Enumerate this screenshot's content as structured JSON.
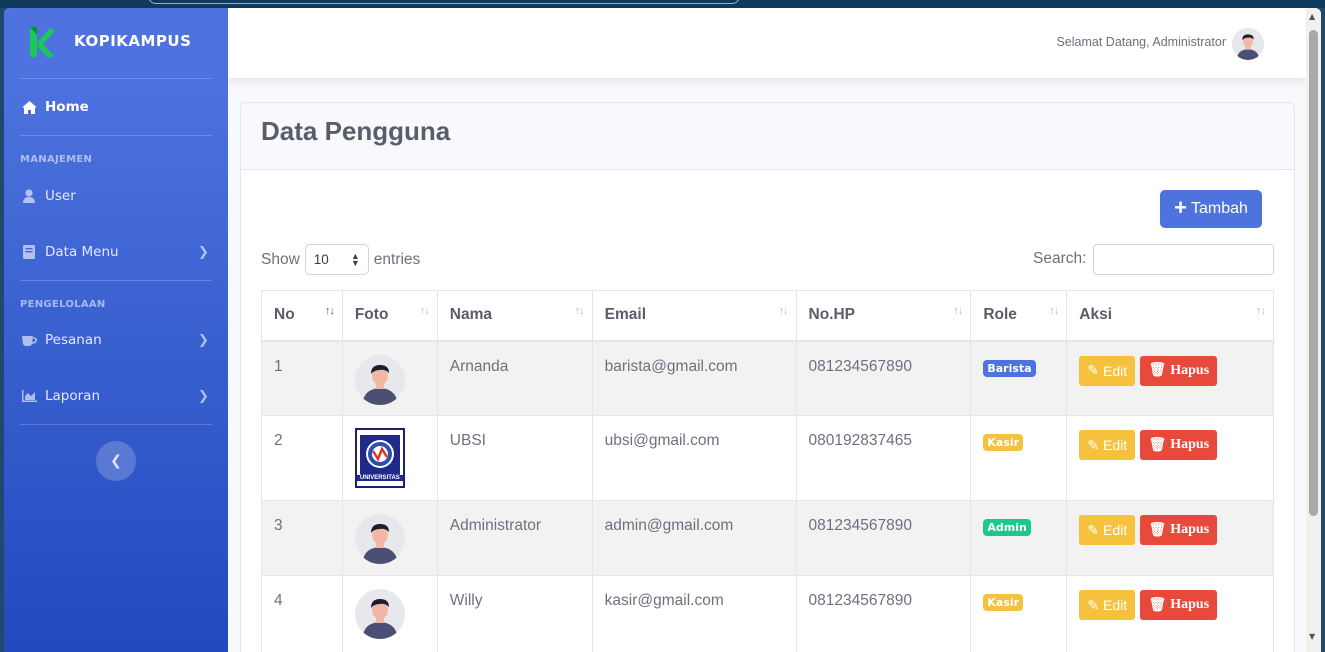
{
  "app": {
    "brand": "KOPIKAMPUS"
  },
  "topbar": {
    "welcome": "Selamat Datang, Administrator"
  },
  "sidebar": {
    "home": "Home",
    "section_manajemen": "MANAJEMEN",
    "user": "User",
    "data_menu": "Data Menu",
    "section_pengelolaan": "PENGELOLAAN",
    "pesanan": "Pesanan",
    "laporan": "Laporan"
  },
  "page": {
    "title": "Data Pengguna",
    "add_button": "Tambah",
    "show_label": "Show",
    "entries_value": "10",
    "entries_label": "entries",
    "search_label": "Search:"
  },
  "table": {
    "headers": [
      "No",
      "Foto",
      "Nama",
      "Email",
      "No.HP",
      "Role",
      "Aksi"
    ],
    "edit_label": "Edit",
    "delete_label": "Hapus",
    "rows": [
      {
        "no": "1",
        "foto": "avatar",
        "nama": "Arnanda",
        "email": "barista@gmail.com",
        "hp": "081234567890",
        "role": "Barista"
      },
      {
        "no": "2",
        "foto": "ubsi-logo",
        "nama": "UBSI",
        "email": "ubsi@gmail.com",
        "hp": "080192837465",
        "role": "Kasir"
      },
      {
        "no": "3",
        "foto": "avatar",
        "nama": "Administrator",
        "email": "admin@gmail.com",
        "hp": "081234567890",
        "role": "Admin"
      },
      {
        "no": "4",
        "foto": "avatar",
        "nama": "Willy",
        "email": "kasir@gmail.com",
        "hp": "081234567890",
        "role": "Kasir"
      }
    ]
  },
  "colors": {
    "primary": "#4e73df",
    "warning": "#f6c23e",
    "danger": "#e74a3b",
    "success": "#1cc88a",
    "brand_green": "#1cc85a"
  },
  "logo_text": {
    "ubsi_bottom": "UNIVERSITAS"
  }
}
